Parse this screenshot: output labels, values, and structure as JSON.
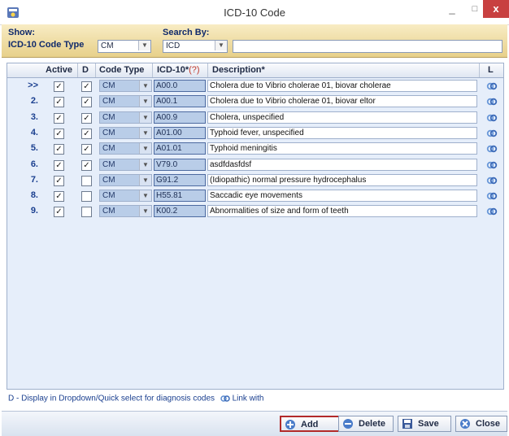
{
  "window": {
    "title": "ICD-10 Code",
    "min": "_",
    "max": "□",
    "close": "x"
  },
  "filter": {
    "show_label": "Show:",
    "code_type_label": "ICD-10 Code Type",
    "code_type_value": "CM",
    "search_by_label": "Search By:",
    "search_by_value": "ICD",
    "search_value": ""
  },
  "grid": {
    "headers": {
      "active": "Active",
      "d": "D",
      "code_type": "Code Type",
      "icd10": "ICD-10*",
      "icd10_help": "(?)",
      "description": "Description*",
      "l": "L"
    },
    "rows": [
      {
        "num": ">>",
        "active": true,
        "d": true,
        "code_type": "CM",
        "code": "A00.0",
        "description": "Cholera due to Vibrio cholerae 01, biovar cholerae"
      },
      {
        "num": "2.",
        "active": true,
        "d": true,
        "code_type": "CM",
        "code": "A00.1",
        "description": "Cholera due to Vibrio cholerae 01, biovar eltor"
      },
      {
        "num": "3.",
        "active": true,
        "d": true,
        "code_type": "CM",
        "code": "A00.9",
        "description": "Cholera, unspecified"
      },
      {
        "num": "4.",
        "active": true,
        "d": true,
        "code_type": "CM",
        "code": "A01.00",
        "description": "Typhoid fever, unspecified"
      },
      {
        "num": "5.",
        "active": true,
        "d": true,
        "code_type": "CM",
        "code": "A01.01",
        "description": "Typhoid meningitis"
      },
      {
        "num": "6.",
        "active": true,
        "d": true,
        "code_type": "CM",
        "code": "V79.0",
        "description": "asdfdasfdsf"
      },
      {
        "num": "7.",
        "active": true,
        "d": false,
        "code_type": "CM",
        "code": "G91.2",
        "description": "(Idiopathic) normal pressure hydrocephalus"
      },
      {
        "num": "8.",
        "active": true,
        "d": false,
        "code_type": "CM",
        "code": "H55.81",
        "description": "Saccadic eye movements"
      },
      {
        "num": "9.",
        "active": true,
        "d": false,
        "code_type": "CM",
        "code": "K00.2",
        "description": "Abnormalities of size and form of teeth"
      }
    ]
  },
  "legend": {
    "d_text": "D - Display in Dropdown/Quick select for diagnosis codes",
    "link_text": "Link with"
  },
  "buttons": {
    "add": "Add",
    "delete": "Delete",
    "save": "Save",
    "close": "Close"
  },
  "colors": {
    "accent": "#e7d08a",
    "grid_bg": "#e6eefa",
    "highlight": "#b22a2a"
  }
}
